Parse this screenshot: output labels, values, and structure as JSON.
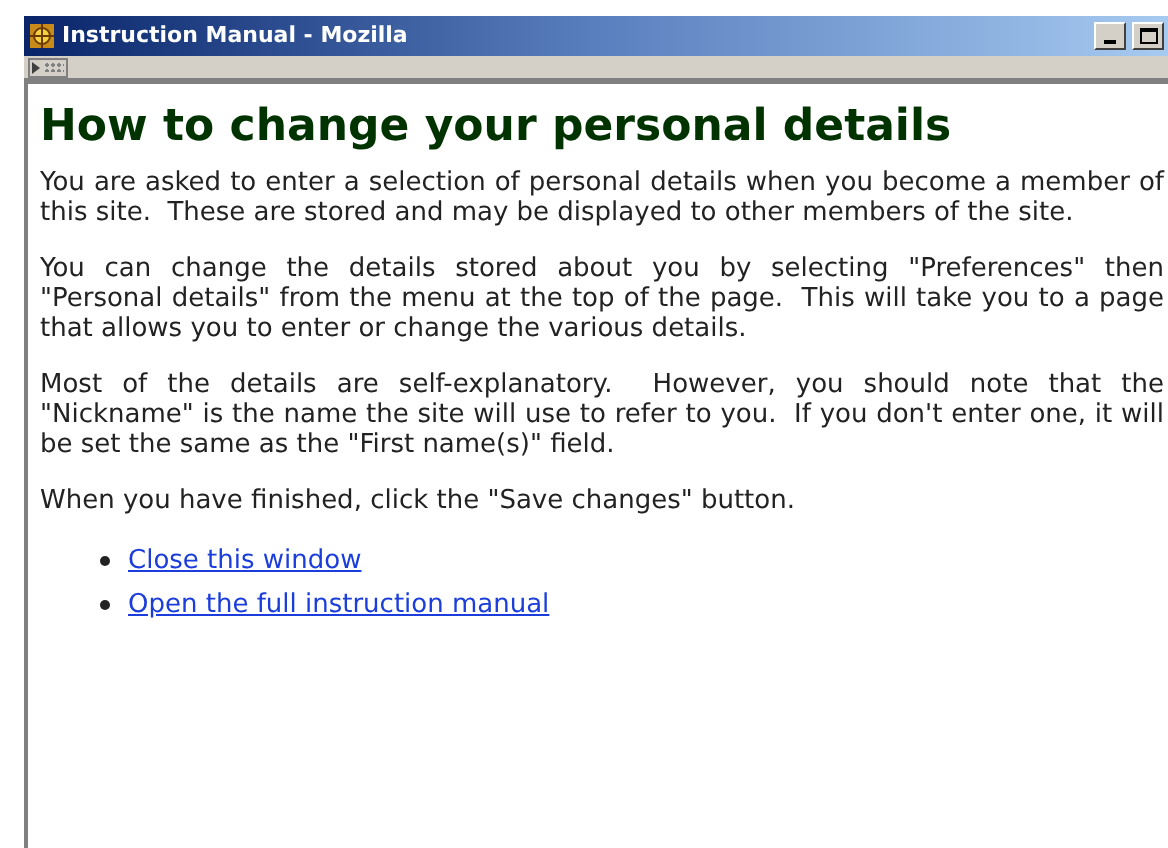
{
  "window": {
    "title": "Instruction Manual - Mozilla"
  },
  "heading": "How to change your personal details",
  "paragraphs": [
    "You are asked to enter a selection of personal details when you become a member of this site.  These are stored and may be displayed to other members of the site.",
    "You can change the details stored about you by selecting \"Preferences\" then \"Personal details\" from the menu at the top of the page.  This will take you to a page that allows you to enter or change the various details.",
    "Most of the details are self-explanatory.  However, you should note that the \"Nickname\" is the name the site will use to refer to you.  If you don't enter one, it will be set the same as the \"First name(s)\" field.",
    "When you have finished, click the \"Save changes\" button."
  ],
  "links": [
    "Close this window",
    "Open the full instruction manual"
  ]
}
